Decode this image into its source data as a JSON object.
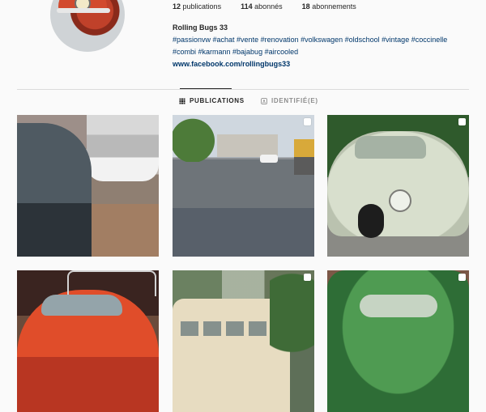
{
  "profile": {
    "stats": {
      "posts": "12",
      "posts_label": "publications",
      "followers": "114",
      "followers_label": "abonnés",
      "following": "18",
      "following_label": "abonnements"
    },
    "name": "Rolling Bugs 33",
    "tags_line1": "#passionvw #achat #vente #renovation #volkswagen #oldschool #vintage #coccinelle",
    "tags_line2": "#combi #karmann #bajabug #aircooled",
    "link": "www.facebook.com/rollingbugs33"
  },
  "tabs": {
    "publications": "PUBLICATIONS",
    "identifie": "IDENTIFIÉ(E)"
  },
  "icons": {
    "grid": "grid-icon",
    "tag": "tag-icon",
    "multi": "multi-photo-icon"
  }
}
